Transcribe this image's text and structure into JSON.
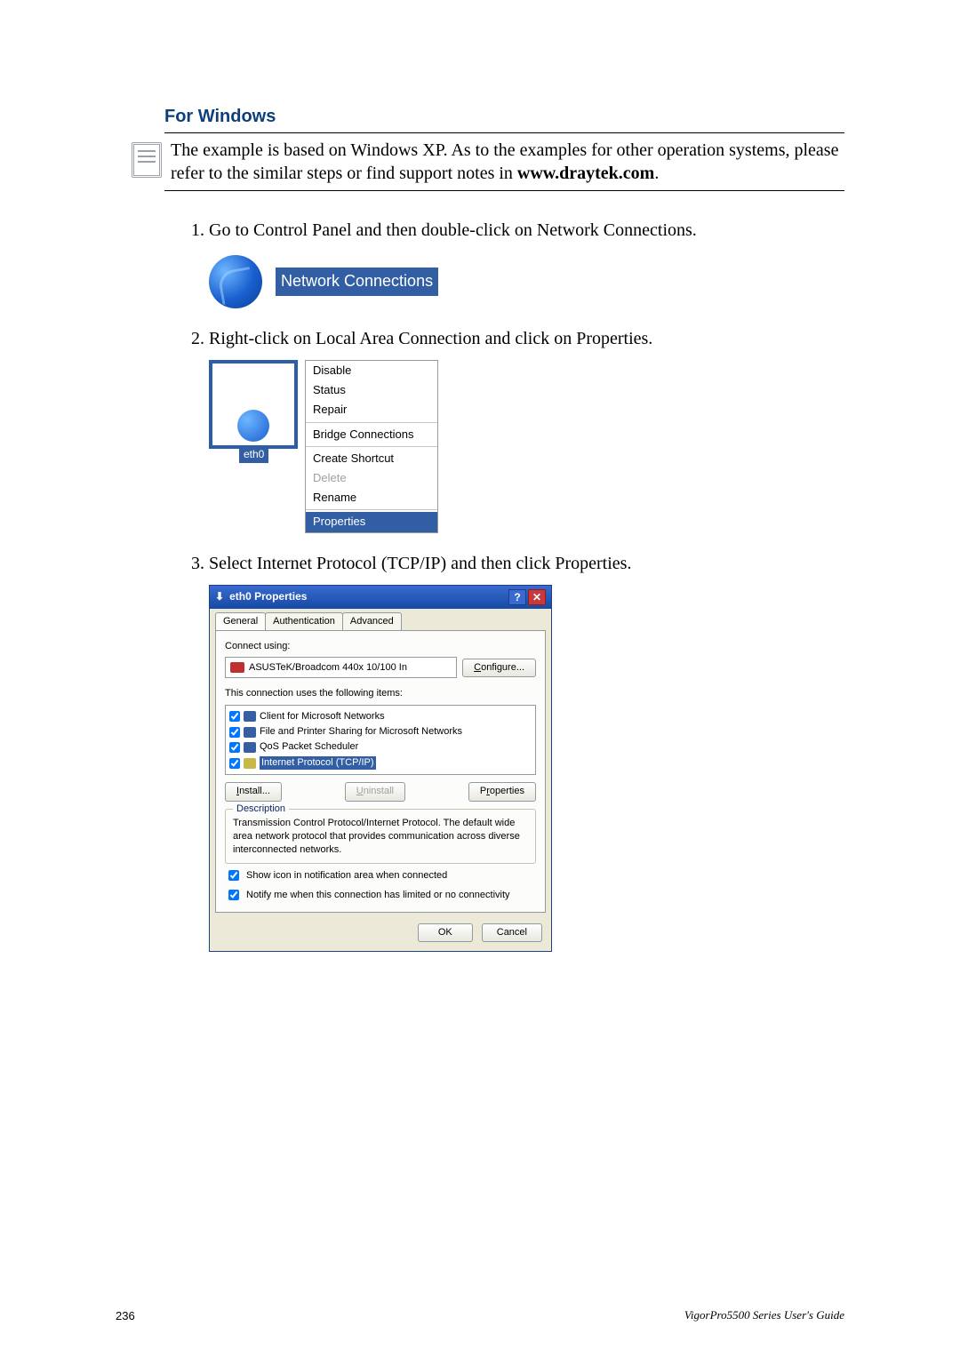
{
  "heading": "For Windows",
  "note": {
    "line1": "The example is based on Windows XP. As to the examples for other operation systems, please refer to the similar steps or find support notes in ",
    "bold": "www.draytek.com",
    "dot": "."
  },
  "steps": [
    "Go to Control Panel and then double-click on Network Connections.",
    "Right-click on Local Area Connection and click on Properties.",
    "Select Internet Protocol (TCP/IP) and then click Properties."
  ],
  "network_connections_label": "Network Connections",
  "context_menu": {
    "eth": "eth0",
    "items": [
      "Disable",
      "Status",
      "Repair"
    ],
    "items2": [
      "Bridge Connections"
    ],
    "items3": [
      "Create Shortcut",
      "Delete",
      "Rename"
    ],
    "properties": "Properties"
  },
  "dialog": {
    "title": "eth0 Properties",
    "tabs": [
      "General",
      "Authentication",
      "Advanced"
    ],
    "connect_using_label": "Connect using:",
    "adapter": "ASUSTeK/Broadcom 440x 10/100 In",
    "configure": "Configure...",
    "uses_label": "This connection uses the following items:",
    "items": [
      "Client for Microsoft Networks",
      "File and Printer Sharing for Microsoft Networks",
      "QoS Packet Scheduler",
      "Internet Protocol (TCP/IP)"
    ],
    "install": "Install...",
    "uninstall": "Uninstall",
    "properties": "Properties",
    "description_label": "Description",
    "description_text": "Transmission Control Protocol/Internet Protocol. The default wide area network protocol that provides communication across diverse interconnected networks.",
    "cb1": "Show icon in notification area when connected",
    "cb2": "Notify me when this connection has limited or no connectivity",
    "ok": "OK",
    "cancel": "Cancel"
  },
  "footer": {
    "page": "236",
    "guide": "VigorPro5500 Series User's Guide"
  }
}
